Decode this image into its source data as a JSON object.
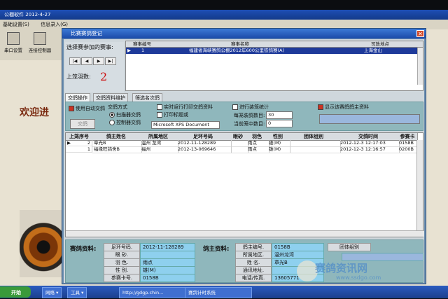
{
  "app": {
    "title": "公棚软件 2012-4-27",
    "menu": [
      "基础设置(S)",
      "信息录入(G)"
    ],
    "toolbar": [
      "串口设置",
      "连接控制器"
    ],
    "welcome": "欢迎进"
  },
  "dialog": {
    "title": "比赛赛鸽登记",
    "select_label": "选择赛参加的赛事:",
    "nav": [
      "|◀",
      "◀",
      "▶",
      "▶|"
    ],
    "count_label": "上笼羽数:",
    "count_value": "2",
    "events": {
      "columns": [
        "赛事编号",
        "赛事名称",
        "司放地点"
      ],
      "rows": [
        {
          "id": "1",
          "name": "福建省海峡赛鸽公棚2012年600公里铁鸽赛(A)",
          "place": "上海金山"
        }
      ]
    },
    "tabs": [
      "交鸽操作",
      "交鸽资料维护",
      "筛选名次鸽"
    ],
    "options": {
      "auto_label": "使用自动交鸽",
      "mode_label": "交鸽方式",
      "mode_scan": "扫描器交鸽",
      "mode_ctrl": "控制器交鸽",
      "realtime_print": "实时返行打印交鸽资料",
      "print_title": "打印标题或",
      "stats": "进行装笼统计",
      "per_cage": "每笼装鸽数目:",
      "per_cage_value": "30",
      "current_cage": "当前笼中数目:",
      "current_cage_value": "0",
      "show_owner": "显示该赛鸽鸽主资料",
      "printer": "Microsoft XPS Document",
      "submit_button": "交鸽"
    },
    "grid": {
      "columns": [
        "上笼序号",
        "鸽主姓名",
        "所属地区",
        "足环号码",
        "眼砂",
        "羽色",
        "性别",
        "团体组别",
        "交鸽时间",
        "参赛卡"
      ],
      "rows": [
        {
          "seq": "2",
          "owner": "章光B",
          "region": "温州 龙湾",
          "ring": "2012-11-128289",
          "eye": "",
          "color": "雨点",
          "sex": "雄(M)",
          "group": "",
          "time": "2012-12-3 12:17:03",
          "card": "0158B"
        },
        {
          "seq": "1",
          "owner": "福缘旺鸽舍B",
          "region": "福州",
          "ring": "2012-13-069646",
          "eye": "",
          "color": "雨点",
          "sex": "雄(M)",
          "group": "",
          "time": "2012-12-3 12:16:57",
          "card": "0200B"
        }
      ]
    },
    "pigeon_info": {
      "title": "赛鸽资料:",
      "ring_label": "足环号码.",
      "ring": "2012-11-128289",
      "eye_label": "眼 砂.",
      "eye": "",
      "color_label": "羽 色.",
      "color": "雨点",
      "sex_label": "性 别.",
      "sex": "雄(M)",
      "card_label": "参赛卡号.",
      "card": "0158B"
    },
    "owner_info": {
      "title": "鸽主资料:",
      "no_label": "鸽主编号.",
      "no": "0158B",
      "region_label": "所属地区.",
      "region": "温州龙湾",
      "name_label": "姓 名.",
      "name": "章光B",
      "addr_label": "通讯地址.",
      "addr": "",
      "phone_label": "电话/传真.",
      "phone": "13605771",
      "group_label": "团体组别"
    }
  },
  "taskbar": {
    "start": "开始",
    "items": [
      "网络 ▾",
      "工具 ▾",
      "http://gdgp.chin...",
      "赛鸽计时系统"
    ]
  },
  "watermark": {
    "main": "赛鸽资讯网",
    "sub": "www.ssdgo.com"
  },
  "colors": {
    "accent": "#1e3a9a",
    "field": "#8ed0ee",
    "panel": "#8fb7bc",
    "alert": "#cc1111"
  }
}
